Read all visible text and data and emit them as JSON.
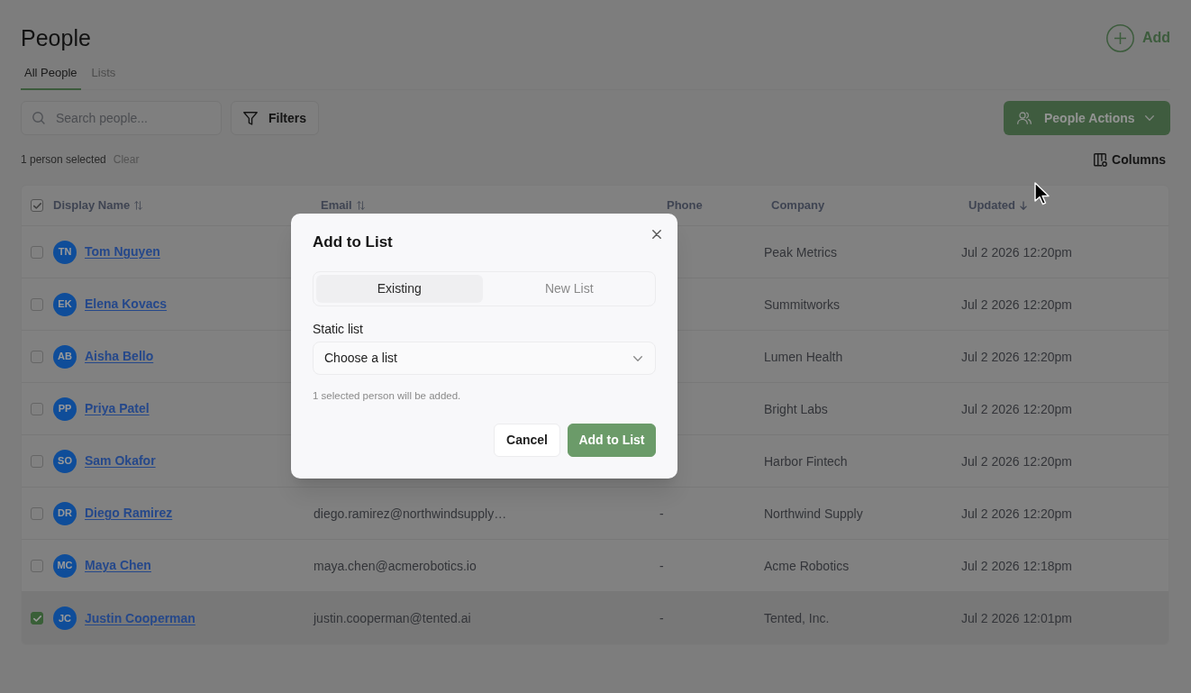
{
  "page": {
    "title": "People",
    "add_button": {
      "label": "Add"
    }
  },
  "tabs": [
    {
      "label": "All People",
      "selected": true
    },
    {
      "label": "Lists",
      "selected": false
    }
  ],
  "toolbar": {
    "search": {
      "placeholder": "Search people..."
    },
    "filters_button": {
      "label": "Filters"
    },
    "actions_button": {
      "label": "People Actions"
    }
  },
  "selection_bar": {
    "summary": "1 person selected",
    "clear_link": "Clear",
    "columns_button": {
      "label": "Columns"
    }
  },
  "table": {
    "select_all": {
      "checked": true
    },
    "columns": [
      {
        "label": "Display Name",
        "sortable": true,
        "sorted_descending": false
      },
      {
        "label": "Email",
        "sortable": true,
        "sorted_descending": false
      },
      {
        "label": "Phone"
      },
      {
        "label": "Company"
      },
      {
        "label": "Updated",
        "sorted_descending": true
      }
    ],
    "rows": [
      {
        "checked": false,
        "initials": "TN",
        "name": "Tom Nguyen",
        "company": "Peak Metrics",
        "updated": "Jul 2 2026 12:20pm"
      },
      {
        "checked": false,
        "initials": "EK",
        "name": "Elena Kovacs",
        "company": "Summitworks",
        "updated": "Jul 2 2026 12:20pm"
      },
      {
        "checked": false,
        "initials": "AB",
        "name": "Aisha Bello",
        "company": "Lumen Health",
        "updated": "Jul 2 2026 12:20pm"
      },
      {
        "checked": false,
        "initials": "PP",
        "name": "Priya Patel",
        "company": "Bright Labs",
        "updated": "Jul 2 2026 12:20pm"
      },
      {
        "checked": false,
        "initials": "SO",
        "name": "Sam Okafor",
        "company": "Harbor Fintech",
        "updated": "Jul 2 2026 12:20pm"
      },
      {
        "checked": false,
        "initials": "DR",
        "name": "Diego Ramirez",
        "email": "diego.ramirez@northwindsupply…",
        "phone": "-",
        "company": "Northwind Supply",
        "updated": "Jul 2 2026 12:20pm"
      },
      {
        "checked": false,
        "initials": "MC",
        "name": "Maya Chen",
        "email": "maya.chen@acmerobotics.io",
        "phone": "-",
        "company": "Acme Robotics",
        "updated": "Jul 2 2026 12:18pm"
      },
      {
        "checked": true,
        "initials": "JC",
        "name": "Justin Cooperman",
        "email": "justin.cooperman@tented.ai",
        "phone": "-",
        "company": "Tented, Inc.",
        "updated": "Jul 2 2026 12:01pm"
      }
    ]
  },
  "dialog": {
    "title": "Add to List",
    "tabs": [
      {
        "label": "Existing",
        "selected": true
      },
      {
        "label": "New List",
        "selected": false
      }
    ],
    "field_label": "Static list",
    "select": {
      "placeholder": "Choose a list"
    },
    "helper_text": "1 selected person will be added.",
    "buttons": [
      {
        "label": "Cancel",
        "kind": "secondary"
      },
      {
        "label": "Add to List",
        "kind": "primary"
      }
    ]
  }
}
